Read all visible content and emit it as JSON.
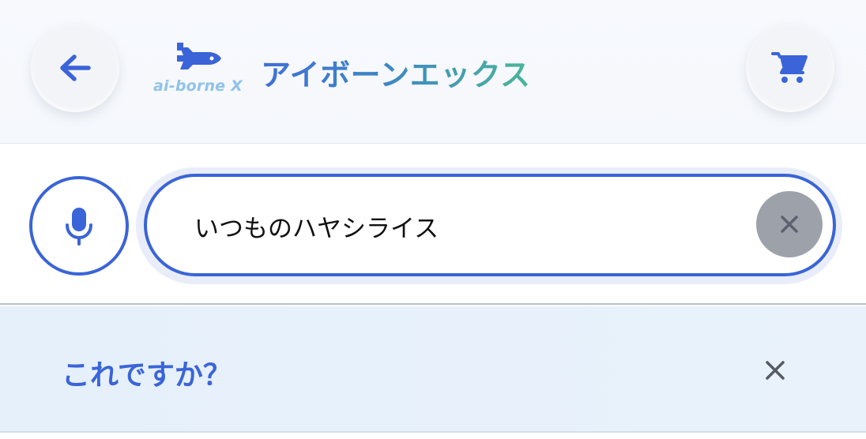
{
  "header": {
    "back_icon": "arrow-left-icon",
    "logo_text": "ai-borne X",
    "brand_title": "アイボーンエックス",
    "cart_icon": "shopping-cart-icon"
  },
  "search": {
    "mic_icon": "microphone-icon",
    "value": "いつものハヤシライス",
    "clear_icon": "close-icon"
  },
  "suggestion": {
    "title": "これですか？",
    "close_icon": "close-icon"
  },
  "colors": {
    "accent": "#3a64d8",
    "brand_gradient_start": "#3f6fd6",
    "brand_gradient_end": "#4cb59a",
    "clear_button": "#9da1aa",
    "suggest_bg": "#e6f0fb"
  }
}
